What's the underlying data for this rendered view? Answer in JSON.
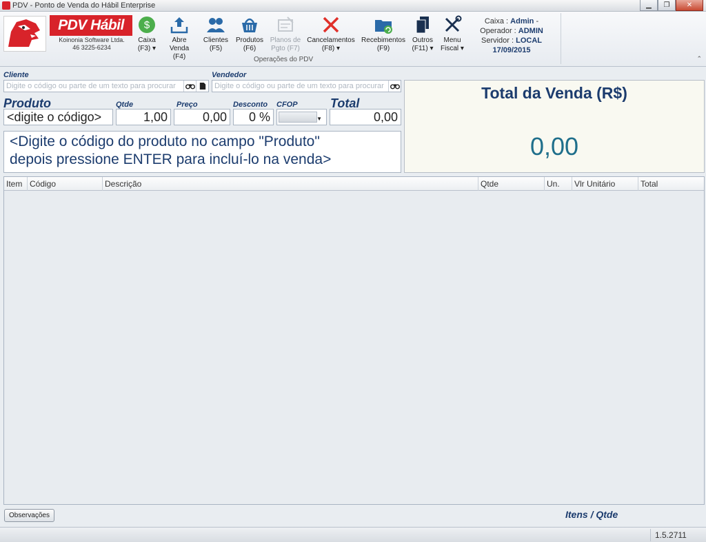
{
  "window": {
    "title": "PDV - Ponto de Venda do Hábil Enterprise",
    "minimize": "▁",
    "maximize": "❐",
    "close": "✕"
  },
  "logo": {
    "brand": "PDV Hábil",
    "company": "Koinonia Software Ltda.",
    "phone": "46 3225-6234"
  },
  "toolbar": {
    "group_label": "Operações do PDV",
    "buttons": [
      {
        "line1": "Caixa",
        "line2": "(F3) ▾"
      },
      {
        "line1": "Abre",
        "line2": "Venda (F4)"
      },
      {
        "line1": "Clientes",
        "line2": "(F5)"
      },
      {
        "line1": "Produtos",
        "line2": "(F6)"
      },
      {
        "line1": "Planos de",
        "line2": "Pgto (F7)"
      },
      {
        "line1": "Cancelamentos",
        "line2": "(F8) ▾"
      },
      {
        "line1": "Recebimentos",
        "line2": "(F9)"
      },
      {
        "line1": "Outros",
        "line2": "(F11) ▾"
      },
      {
        "line1": "Menu",
        "line2": "Fiscal ▾"
      }
    ]
  },
  "session": {
    "caixa_label": "Caixa :",
    "caixa_value": "Admin",
    "caixa_suffix": "-",
    "operador_label": "Operador :",
    "operador_value": "ADMIN",
    "servidor_label": "Servidor :",
    "servidor_value": "LOCAL",
    "date": "17/09/2015"
  },
  "form": {
    "cliente_label": "Cliente",
    "cliente_placeholder": "Digite o código ou parte de um texto para procurar",
    "vendedor_label": "Vendedor",
    "vendedor_placeholder": "Digite o código ou parte de um texto para procurar",
    "produto_label": "Produto",
    "produto_value": "<digite o código>",
    "qtde_label": "Qtde",
    "qtde_value": "1,00",
    "preco_label": "Preço",
    "preco_value": "0,00",
    "desconto_label": "Desconto",
    "desconto_value": "0 %",
    "cfop_label": "CFOP",
    "total_label": "Total",
    "total_value": "0,00"
  },
  "hint": {
    "line1": "<Digite o código do produto no campo \"Produto\"",
    "line2": "depois pressione ENTER para incluí-lo na venda>"
  },
  "sale_total": {
    "title": "Total da Venda (R$)",
    "value": "0,00"
  },
  "grid": {
    "columns": [
      "Item",
      "Código",
      "Descrição",
      "Qtde",
      "Un.",
      "Vlr Unitário",
      "Total"
    ],
    "rows": []
  },
  "footer": {
    "obs_button": "Observações",
    "items_label": "Itens / Qtde",
    "version": "1.5.2711"
  },
  "colors": {
    "brand_red": "#d8232a",
    "accent_navy": "#1c3c6e",
    "total_teal": "#1f6f8b"
  }
}
